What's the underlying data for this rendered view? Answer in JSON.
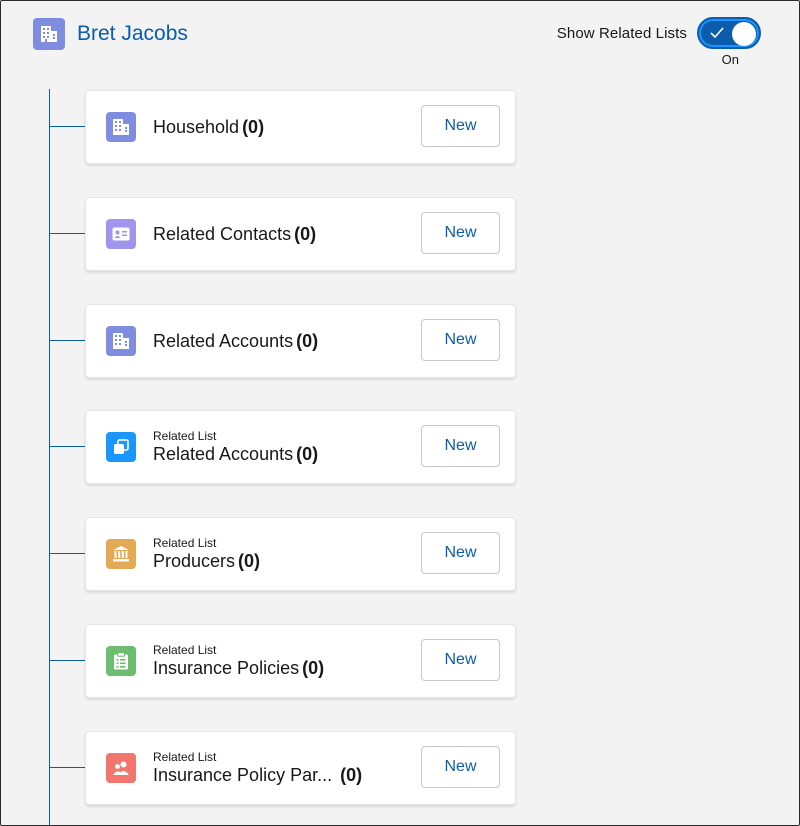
{
  "header": {
    "title": "Bret Jacobs",
    "icon": "building-icon",
    "icon_color": "#7f8de1"
  },
  "toggle": {
    "label": "Show Related Lists",
    "state": "On",
    "checked": true,
    "color": "#0b5cab"
  },
  "cards": [
    {
      "subtitle": "",
      "title": "Household",
      "count": "(0)",
      "icon": "building-icon",
      "icon_color": "#7f8de1",
      "button": "New"
    },
    {
      "subtitle": "",
      "title": "Related Contacts",
      "count": "(0)",
      "icon": "contact-card-icon",
      "icon_color": "#a094ed",
      "button": "New"
    },
    {
      "subtitle": "",
      "title": "Related Accounts",
      "count": "(0)",
      "icon": "building-icon",
      "icon_color": "#7f8de1",
      "button": "New"
    },
    {
      "subtitle": "Related List",
      "title": "Related Accounts",
      "count": "(0)",
      "icon": "overlapping-squares-icon",
      "icon_color": "#1b96ff",
      "button": "New"
    },
    {
      "subtitle": "Related List",
      "title": "Producers",
      "count": "(0)",
      "icon": "bank-icon",
      "icon_color": "#e3a954",
      "button": "New"
    },
    {
      "subtitle": "Related List",
      "title": "Insurance Policies",
      "count": "(0)",
      "icon": "clipboard-list-icon",
      "icon_color": "#6cbd70",
      "button": "New"
    },
    {
      "subtitle": "Related List",
      "title": "Insurance Policy Par...",
      "count": "(0)",
      "icon": "people-icon",
      "icon_color": "#f2756e",
      "button": "New"
    }
  ]
}
